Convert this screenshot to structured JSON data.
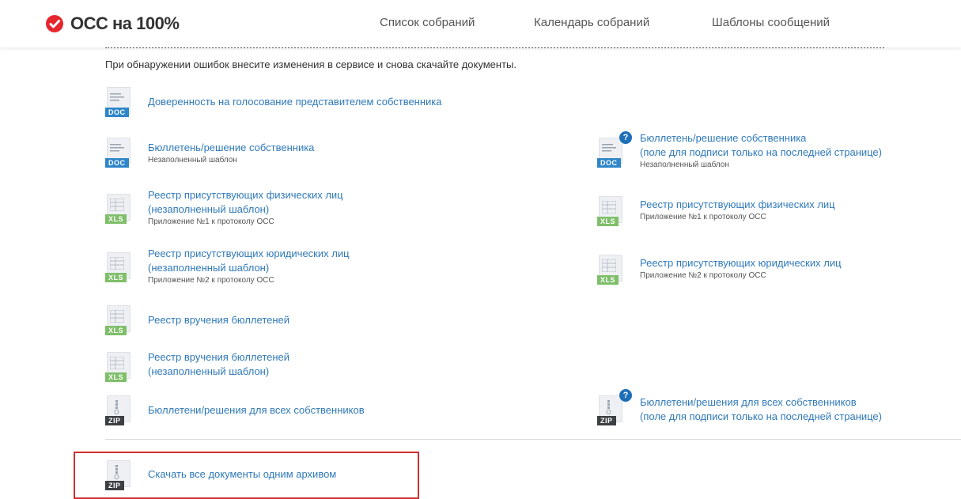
{
  "app": {
    "logo_text": "ОСС на 100%",
    "logo_color": "#e5262d"
  },
  "nav": {
    "items": [
      {
        "label": "Список собраний"
      },
      {
        "label": "Календарь собраний"
      },
      {
        "label": "Шаблоны сообщений"
      }
    ]
  },
  "notice": "При обнаружении ошибок внесите изменения в сервисе и снова скачайте документы.",
  "documents": {
    "left": [
      {
        "type": "DOC",
        "title": [
          "Доверенность на голосование представителем собственника"
        ],
        "subtitle": ""
      },
      {
        "type": "DOC",
        "title": [
          "Бюллетень/решение собственника"
        ],
        "subtitle": "Незаполненный шаблон"
      },
      {
        "type": "XLS",
        "title": [
          "Реестр присутствующих физических лиц",
          "(незаполненный шаблон)"
        ],
        "subtitle": "Приложение №1 к протоколу ОСС"
      },
      {
        "type": "XLS",
        "title": [
          "Реестр присутствующих юридических лиц",
          "(незаполненный шаблон)"
        ],
        "subtitle": "Приложение №2 к протоколу ОСС"
      },
      {
        "type": "XLS",
        "title": [
          "Реестр вручения бюллетеней"
        ],
        "subtitle": ""
      },
      {
        "type": "XLS",
        "title": [
          "Реестр вручения бюллетеней",
          "(незаполненный шаблон)"
        ],
        "subtitle": ""
      },
      {
        "type": "ZIP",
        "title": [
          "Бюллетени/решения для всех собственников"
        ],
        "subtitle": ""
      }
    ],
    "right": [
      {
        "type": "DOC",
        "title": [
          "Бюллетень/решение собственника",
          "(поле для подписи только на последней странице)"
        ],
        "subtitle": "Незаполненный шаблон",
        "help": "?"
      },
      {
        "type": "XLS",
        "title": [
          "Реестр присутствующих физических лиц"
        ],
        "subtitle": "Приложение №1 к протоколу ОСС"
      },
      {
        "type": "XLS",
        "title": [
          "Реестр присутствующих юридических лиц"
        ],
        "subtitle": "Приложение №2 к протоколу ОСС"
      },
      {
        "type": "ZIP",
        "title": [
          "Бюллетени/решения для всех собственников",
          "(поле для подписи только на последней странице)"
        ],
        "subtitle": "",
        "help": "?"
      }
    ]
  },
  "download_all": {
    "type": "ZIP",
    "title": "Скачать все документы одним архивом"
  },
  "colors": {
    "link": "#2f79b9",
    "doc_badge": "#2e86c9",
    "xls_badge": "#7fbf6a",
    "zip_badge": "#3c4043",
    "highlight": "#d32f2f"
  }
}
